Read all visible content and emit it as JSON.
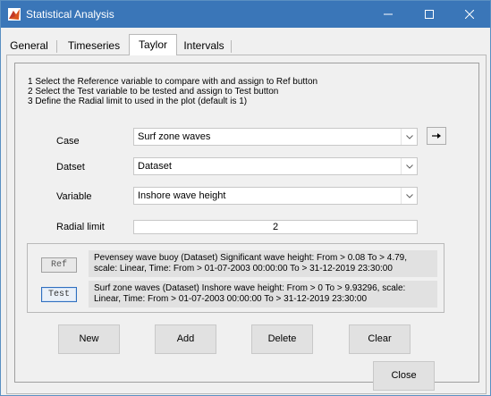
{
  "window": {
    "title": "Statistical Analysis",
    "title_bar_color": "#3a76b8"
  },
  "tabs": [
    {
      "label": "General"
    },
    {
      "label": "Timeseries"
    },
    {
      "label": "Taylor",
      "active": true
    },
    {
      "label": "Intervals"
    }
  ],
  "instructions": [
    "1 Select the Reference variable to compare with and assign to Ref button",
    "2 Select the Test variable to be tested and assign to Test button",
    "3 Define the Radial limit to used in the plot (default is 1)"
  ],
  "form": {
    "case_label": "Case",
    "case_value": "Surf zone waves",
    "dataset_label": "Datset",
    "dataset_value": "Dataset",
    "variable_label": "Variable",
    "variable_value": "Inshore wave height",
    "radial_label": "Radial limit",
    "radial_value": "2"
  },
  "selection": {
    "ref_label": "Ref",
    "ref_desc": "Pevensey wave buoy (Dataset) Significant wave height: From > 0.08 To > 4.79, scale: Linear, Time: From > 01-07-2003 00:00:00 To > 31-12-2019 23:30:00",
    "test_label": "Test",
    "test_desc": "Surf zone waves (Dataset) Inshore wave height: From > 0 To > 9.93296, scale: Linear, Time: From > 01-07-2003 00:00:00 To > 31-12-2019 23:30:00"
  },
  "buttons": {
    "new": "New",
    "add": "Add",
    "delete": "Delete",
    "clear": "Clear",
    "close": "Close"
  }
}
